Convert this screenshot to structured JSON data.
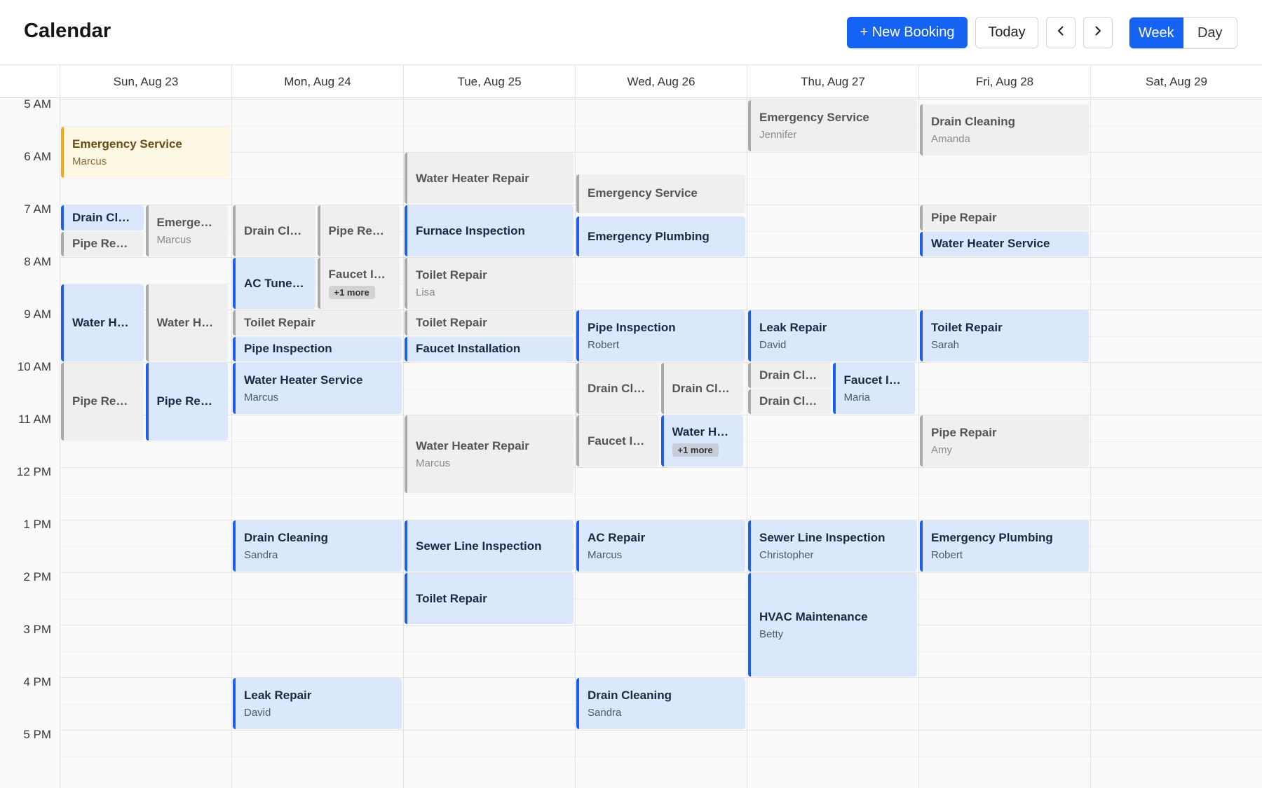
{
  "app": {
    "title": "Calendar"
  },
  "toolbar": {
    "new_booking_label": "+ New Booking",
    "today_label": "Today",
    "prev_icon": "chevron-left-icon",
    "next_icon": "chevron-right-icon",
    "views": [
      {
        "label": "Week",
        "active": true
      },
      {
        "label": "Day",
        "active": false
      }
    ]
  },
  "colors": {
    "accent": "#1463f3",
    "event_blue": "#dbe7fb",
    "event_gray": "#efefef",
    "event_yellow": "#fdf8e4",
    "event_yellow_border": "#f5a623"
  },
  "days": [
    "Sun, Aug 23",
    "Mon, Aug 24",
    "Tue, Aug 25",
    "Wed, Aug 26",
    "Thu, Aug 27",
    "Fri, Aug 28",
    "Sat, Aug 29"
  ],
  "hours": [
    "5 AM",
    "6 AM",
    "7 AM",
    "8 AM",
    "9 AM",
    "10 AM",
    "11 AM",
    "12 PM",
    "1 PM",
    "2 PM",
    "3 PM",
    "4 PM",
    "5 PM"
  ],
  "events": [
    {
      "day": 0,
      "start": "5:30",
      "end": "6:30",
      "lane": 0,
      "lanes": 1,
      "color": "yellow",
      "title": "Emergency Service",
      "sub": "Marcus"
    },
    {
      "day": 0,
      "start": "7:00",
      "end": "7:30",
      "lane": 0,
      "lanes": 2,
      "color": "blue",
      "title": "Drain Cleaning",
      "sub": ""
    },
    {
      "day": 0,
      "start": "7:30",
      "end": "8:00",
      "lane": 0,
      "lanes": 2,
      "color": "gray",
      "title": "Pipe Repair",
      "sub": ""
    },
    {
      "day": 0,
      "start": "7:00",
      "end": "8:00",
      "lane": 1,
      "lanes": 2,
      "color": "gray",
      "title": "Emergency Service",
      "sub": "Marcus"
    },
    {
      "day": 0,
      "start": "8:30",
      "end": "10:00",
      "lane": 0,
      "lanes": 2,
      "color": "blue",
      "title": "Water Heater Repair",
      "sub": ""
    },
    {
      "day": 0,
      "start": "8:30",
      "end": "10:00",
      "lane": 1,
      "lanes": 2,
      "color": "gray",
      "title": "Water Heater Repair",
      "sub": ""
    },
    {
      "day": 0,
      "start": "10:00",
      "end": "11:30",
      "lane": 0,
      "lanes": 2,
      "color": "gray",
      "title": "Pipe Repair",
      "sub": ""
    },
    {
      "day": 0,
      "start": "10:00",
      "end": "11:30",
      "lane": 1,
      "lanes": 2,
      "color": "blue",
      "title": "Pipe Repair",
      "sub": ""
    },
    {
      "day": 1,
      "start": "7:00",
      "end": "8:00",
      "lane": 0,
      "lanes": 2,
      "color": "gray",
      "title": "Drain Cleaning",
      "sub": ""
    },
    {
      "day": 1,
      "start": "7:00",
      "end": "8:00",
      "lane": 1,
      "lanes": 2,
      "color": "gray",
      "title": "Pipe Repair",
      "sub": ""
    },
    {
      "day": 1,
      "start": "8:00",
      "end": "9:00",
      "lane": 0,
      "lanes": 2,
      "color": "blue",
      "title": "AC Tune-Up",
      "sub": ""
    },
    {
      "day": 1,
      "start": "8:00",
      "end": "9:00",
      "lane": 1,
      "lanes": 2,
      "color": "gray",
      "title": "Faucet Installation",
      "sub": "",
      "more": "+1 more"
    },
    {
      "day": 1,
      "start": "9:00",
      "end": "9:30",
      "lane": 0,
      "lanes": 1,
      "color": "gray",
      "title": "Toilet Repair",
      "sub": ""
    },
    {
      "day": 1,
      "start": "9:30",
      "end": "10:00",
      "lane": 0,
      "lanes": 1,
      "color": "blue",
      "title": "Pipe Inspection",
      "sub": ""
    },
    {
      "day": 1,
      "start": "10:00",
      "end": "11:00",
      "lane": 0,
      "lanes": 1,
      "color": "blue",
      "title": "Water Heater Service",
      "sub": "Marcus"
    },
    {
      "day": 1,
      "start": "13:00",
      "end": "14:00",
      "lane": 0,
      "lanes": 1,
      "color": "blue",
      "title": "Drain Cleaning",
      "sub": "Sandra"
    },
    {
      "day": 1,
      "start": "16:00",
      "end": "17:00",
      "lane": 0,
      "lanes": 1,
      "color": "blue",
      "title": "Leak Repair",
      "sub": "David"
    },
    {
      "day": 2,
      "start": "6:00",
      "end": "7:00",
      "lane": 0,
      "lanes": 1,
      "color": "gray",
      "title": "Water Heater Repair",
      "sub": ""
    },
    {
      "day": 2,
      "start": "7:00",
      "end": "8:00",
      "lane": 0,
      "lanes": 1,
      "color": "blue",
      "title": "Furnace Inspection",
      "sub": ""
    },
    {
      "day": 2,
      "start": "8:00",
      "end": "9:00",
      "lane": 0,
      "lanes": 1,
      "color": "gray",
      "title": "Toilet Repair",
      "sub": "Lisa"
    },
    {
      "day": 2,
      "start": "9:00",
      "end": "9:30",
      "lane": 0,
      "lanes": 1,
      "color": "gray",
      "title": "Toilet Repair",
      "sub": ""
    },
    {
      "day": 2,
      "start": "9:30",
      "end": "10:00",
      "lane": 0,
      "lanes": 1,
      "color": "blue",
      "title": "Faucet Installation",
      "sub": ""
    },
    {
      "day": 2,
      "start": "11:00",
      "end": "12:30",
      "lane": 0,
      "lanes": 1,
      "color": "gray",
      "title": "Water Heater Repair",
      "sub": "Marcus"
    },
    {
      "day": 2,
      "start": "13:00",
      "end": "14:00",
      "lane": 0,
      "lanes": 1,
      "color": "blue",
      "title": "Sewer Line Inspection",
      "sub": ""
    },
    {
      "day": 2,
      "start": "14:00",
      "end": "15:00",
      "lane": 0,
      "lanes": 1,
      "color": "blue",
      "title": "Toilet Repair",
      "sub": ""
    },
    {
      "day": 3,
      "start": "6:25",
      "end": "7:10",
      "lane": 0,
      "lanes": 1,
      "color": "gray",
      "title": "Emergency Service",
      "sub": ""
    },
    {
      "day": 3,
      "start": "7:13",
      "end": "8:00",
      "lane": 0,
      "lanes": 1,
      "color": "blue",
      "title": "Emergency Plumbing",
      "sub": ""
    },
    {
      "day": 3,
      "start": "9:00",
      "end": "10:00",
      "lane": 0,
      "lanes": 1,
      "color": "blue",
      "title": "Pipe Inspection",
      "sub": "Robert"
    },
    {
      "day": 3,
      "start": "10:00",
      "end": "11:00",
      "lane": 0,
      "lanes": 2,
      "color": "gray",
      "title": "Drain Cleaning",
      "sub": ""
    },
    {
      "day": 3,
      "start": "10:00",
      "end": "11:00",
      "lane": 1,
      "lanes": 2,
      "color": "gray",
      "title": "Drain Cleaning",
      "sub": ""
    },
    {
      "day": 3,
      "start": "11:00",
      "end": "12:00",
      "lane": 0,
      "lanes": 2,
      "color": "gray",
      "title": "Faucet Installation",
      "sub": ""
    },
    {
      "day": 3,
      "start": "11:00",
      "end": "12:00",
      "lane": 1,
      "lanes": 2,
      "color": "blue",
      "title": "Water Heater Repair",
      "sub": "",
      "more": "+1 more"
    },
    {
      "day": 3,
      "start": "13:00",
      "end": "14:00",
      "lane": 0,
      "lanes": 1,
      "color": "blue",
      "title": "AC Repair",
      "sub": "Marcus"
    },
    {
      "day": 3,
      "start": "16:00",
      "end": "17:00",
      "lane": 0,
      "lanes": 1,
      "color": "blue",
      "title": "Drain Cleaning",
      "sub": "Sandra"
    },
    {
      "day": 4,
      "start": "5:00",
      "end": "6:00",
      "lane": 0,
      "lanes": 1,
      "color": "gray",
      "title": "Emergency Service",
      "sub": "Jennifer"
    },
    {
      "day": 4,
      "start": "9:00",
      "end": "10:00",
      "lane": 0,
      "lanes": 1,
      "color": "blue",
      "title": "Leak Repair",
      "sub": "David"
    },
    {
      "day": 4,
      "start": "10:00",
      "end": "10:30",
      "lane": 0,
      "lanes": 2,
      "color": "gray",
      "title": "Drain Cleaning",
      "sub": ""
    },
    {
      "day": 4,
      "start": "10:30",
      "end": "11:00",
      "lane": 0,
      "lanes": 2,
      "color": "gray",
      "title": "Drain Cleaning",
      "sub": ""
    },
    {
      "day": 4,
      "start": "10:00",
      "end": "11:00",
      "lane": 1,
      "lanes": 2,
      "color": "blue",
      "title": "Faucet Installation",
      "sub": "Maria"
    },
    {
      "day": 4,
      "start": "13:00",
      "end": "14:00",
      "lane": 0,
      "lanes": 1,
      "color": "blue",
      "title": "Sewer Line Inspection",
      "sub": "Christopher"
    },
    {
      "day": 4,
      "start": "14:00",
      "end": "16:00",
      "lane": 0,
      "lanes": 1,
      "color": "blue",
      "title": "HVAC Maintenance",
      "sub": "Betty"
    },
    {
      "day": 5,
      "start": "5:05",
      "end": "6:05",
      "lane": 0,
      "lanes": 1,
      "color": "gray",
      "title": "Drain Cleaning",
      "sub": "Amanda"
    },
    {
      "day": 5,
      "start": "7:00",
      "end": "7:30",
      "lane": 0,
      "lanes": 1,
      "color": "gray",
      "title": "Pipe Repair",
      "sub": ""
    },
    {
      "day": 5,
      "start": "7:30",
      "end": "8:00",
      "lane": 0,
      "lanes": 1,
      "color": "blue",
      "title": "Water Heater Service",
      "sub": ""
    },
    {
      "day": 5,
      "start": "9:00",
      "end": "10:00",
      "lane": 0,
      "lanes": 1,
      "color": "blue",
      "title": "Toilet Repair",
      "sub": "Sarah"
    },
    {
      "day": 5,
      "start": "11:00",
      "end": "12:00",
      "lane": 0,
      "lanes": 1,
      "color": "gray",
      "title": "Pipe Repair",
      "sub": "Amy"
    },
    {
      "day": 5,
      "start": "13:00",
      "end": "14:00",
      "lane": 0,
      "lanes": 1,
      "color": "blue",
      "title": "Emergency Plumbing",
      "sub": "Robert"
    }
  ]
}
